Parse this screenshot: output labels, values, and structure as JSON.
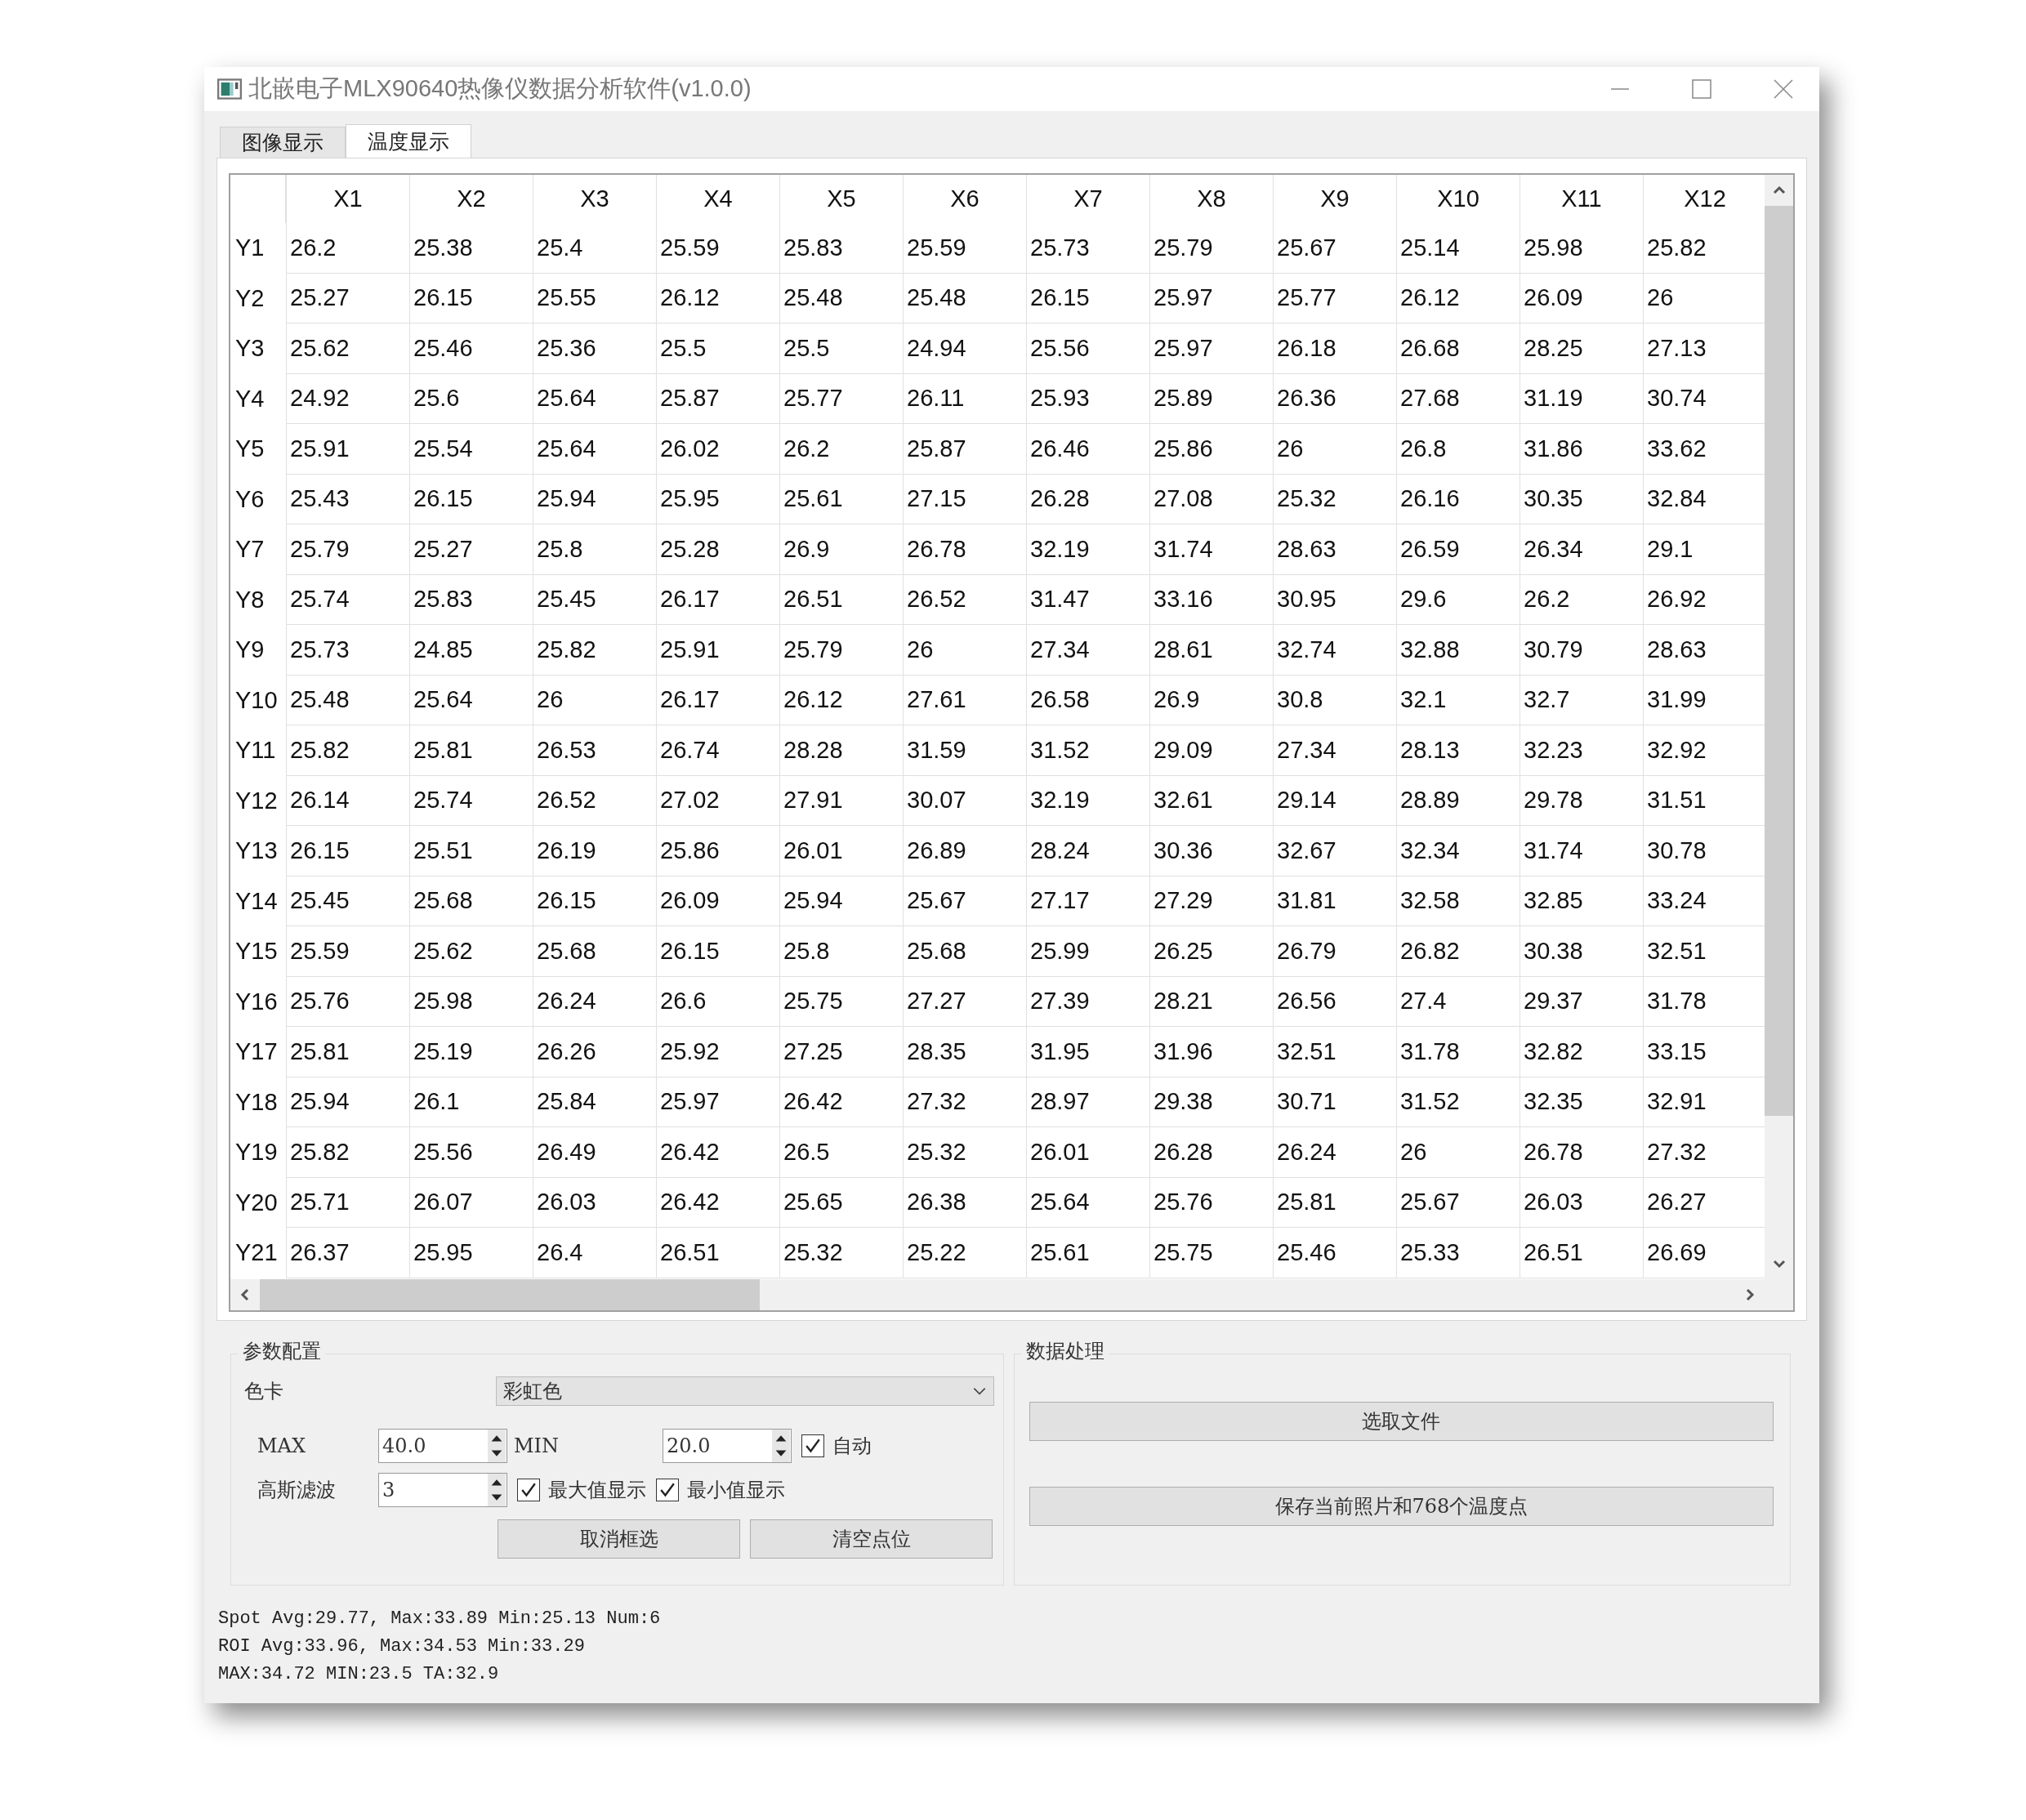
{
  "window": {
    "title": "北嵌电子MLX90640热像仪数据分析软件(v1.0.0)"
  },
  "tabs": [
    {
      "label": "图像显示",
      "selected": false
    },
    {
      "label": "温度显示",
      "selected": true
    }
  ],
  "table": {
    "columns": [
      "X1",
      "X2",
      "X3",
      "X4",
      "X5",
      "X6",
      "X7",
      "X8",
      "X9",
      "X10",
      "X11",
      "X12"
    ],
    "rows": [
      {
        "header": "Y1",
        "cells": [
          "26.2",
          "25.38",
          "25.4",
          "25.59",
          "25.83",
          "25.59",
          "25.73",
          "25.79",
          "25.67",
          "25.14",
          "25.98",
          "25.82"
        ]
      },
      {
        "header": "Y2",
        "cells": [
          "25.27",
          "26.15",
          "25.55",
          "26.12",
          "25.48",
          "25.48",
          "26.15",
          "25.97",
          "25.77",
          "26.12",
          "26.09",
          "26"
        ]
      },
      {
        "header": "Y3",
        "cells": [
          "25.62",
          "25.46",
          "25.36",
          "25.5",
          "25.5",
          "24.94",
          "25.56",
          "25.97",
          "26.18",
          "26.68",
          "28.25",
          "27.13"
        ]
      },
      {
        "header": "Y4",
        "cells": [
          "24.92",
          "25.6",
          "25.64",
          "25.87",
          "25.77",
          "26.11",
          "25.93",
          "25.89",
          "26.36",
          "27.68",
          "31.19",
          "30.74"
        ]
      },
      {
        "header": "Y5",
        "cells": [
          "25.91",
          "25.54",
          "25.64",
          "26.02",
          "26.2",
          "25.87",
          "26.46",
          "25.86",
          "26",
          "26.8",
          "31.86",
          "33.62"
        ]
      },
      {
        "header": "Y6",
        "cells": [
          "25.43",
          "26.15",
          "25.94",
          "25.95",
          "25.61",
          "27.15",
          "26.28",
          "27.08",
          "25.32",
          "26.16",
          "30.35",
          "32.84"
        ]
      },
      {
        "header": "Y7",
        "cells": [
          "25.79",
          "25.27",
          "25.8",
          "25.28",
          "26.9",
          "26.78",
          "32.19",
          "31.74",
          "28.63",
          "26.59",
          "26.34",
          "29.1"
        ]
      },
      {
        "header": "Y8",
        "cells": [
          "25.74",
          "25.83",
          "25.45",
          "26.17",
          "26.51",
          "26.52",
          "31.47",
          "33.16",
          "30.95",
          "29.6",
          "26.2",
          "26.92"
        ]
      },
      {
        "header": "Y9",
        "cells": [
          "25.73",
          "24.85",
          "25.82",
          "25.91",
          "25.79",
          "26",
          "27.34",
          "28.61",
          "32.74",
          "32.88",
          "30.79",
          "28.63"
        ]
      },
      {
        "header": "Y10",
        "cells": [
          "25.48",
          "25.64",
          "26",
          "26.17",
          "26.12",
          "27.61",
          "26.58",
          "26.9",
          "30.8",
          "32.1",
          "32.7",
          "31.99"
        ]
      },
      {
        "header": "Y11",
        "cells": [
          "25.82",
          "25.81",
          "26.53",
          "26.74",
          "28.28",
          "31.59",
          "31.52",
          "29.09",
          "27.34",
          "28.13",
          "32.23",
          "32.92"
        ]
      },
      {
        "header": "Y12",
        "cells": [
          "26.14",
          "25.74",
          "26.52",
          "27.02",
          "27.91",
          "30.07",
          "32.19",
          "32.61",
          "29.14",
          "28.89",
          "29.78",
          "31.51"
        ]
      },
      {
        "header": "Y13",
        "cells": [
          "26.15",
          "25.51",
          "26.19",
          "25.86",
          "26.01",
          "26.89",
          "28.24",
          "30.36",
          "32.67",
          "32.34",
          "31.74",
          "30.78"
        ]
      },
      {
        "header": "Y14",
        "cells": [
          "25.45",
          "25.68",
          "26.15",
          "26.09",
          "25.94",
          "25.67",
          "27.17",
          "27.29",
          "31.81",
          "32.58",
          "32.85",
          "33.24"
        ]
      },
      {
        "header": "Y15",
        "cells": [
          "25.59",
          "25.62",
          "25.68",
          "26.15",
          "25.8",
          "25.68",
          "25.99",
          "26.25",
          "26.79",
          "26.82",
          "30.38",
          "32.51"
        ]
      },
      {
        "header": "Y16",
        "cells": [
          "25.76",
          "25.98",
          "26.24",
          "26.6",
          "25.75",
          "27.27",
          "27.39",
          "28.21",
          "26.56",
          "27.4",
          "29.37",
          "31.78"
        ]
      },
      {
        "header": "Y17",
        "cells": [
          "25.81",
          "25.19",
          "26.26",
          "25.92",
          "27.25",
          "28.35",
          "31.95",
          "31.96",
          "32.51",
          "31.78",
          "32.82",
          "33.15"
        ]
      },
      {
        "header": "Y18",
        "cells": [
          "25.94",
          "26.1",
          "25.84",
          "25.97",
          "26.42",
          "27.32",
          "28.97",
          "29.38",
          "30.71",
          "31.52",
          "32.35",
          "32.91"
        ]
      },
      {
        "header": "Y19",
        "cells": [
          "25.82",
          "25.56",
          "26.49",
          "26.42",
          "26.5",
          "25.32",
          "26.01",
          "26.28",
          "26.24",
          "26",
          "26.78",
          "27.32"
        ]
      },
      {
        "header": "Y20",
        "cells": [
          "25.71",
          "26.07",
          "26.03",
          "26.42",
          "25.65",
          "26.38",
          "25.64",
          "25.76",
          "25.81",
          "25.67",
          "26.03",
          "26.27"
        ]
      },
      {
        "header": "Y21",
        "cells": [
          "26.37",
          "25.95",
          "26.4",
          "26.51",
          "25.32",
          "25.22",
          "25.61",
          "25.75",
          "25.46",
          "25.33",
          "26.51",
          "26.69"
        ]
      }
    ]
  },
  "parameter_config": {
    "title": "参数配置",
    "color_map": {
      "label": "色卡",
      "value": "彩虹色"
    },
    "max": {
      "label": "MAX",
      "value": "40.0"
    },
    "min": {
      "label": "MIN",
      "value": "20.0"
    },
    "auto": {
      "label": "自动",
      "checked": true
    },
    "gaussian_filter": {
      "label": "高斯滤波",
      "value": "3"
    },
    "show_max": {
      "label": "最大值显示",
      "checked": true
    },
    "show_min": {
      "label": "最小值显示",
      "checked": true
    },
    "buttons": [
      "取消框选",
      "清空点位"
    ]
  },
  "data_processing": {
    "title": "数据处理",
    "buttons": [
      "选取文件",
      "保存当前照片和768个温度点"
    ]
  },
  "status_lines": [
    "Spot Avg:29.77, Max:33.89 Min:25.13 Num:6",
    "ROI Avg:33.96, Max:34.53 Min:33.29",
    "MAX:34.72 MIN:23.5 TA:32.9"
  ]
}
